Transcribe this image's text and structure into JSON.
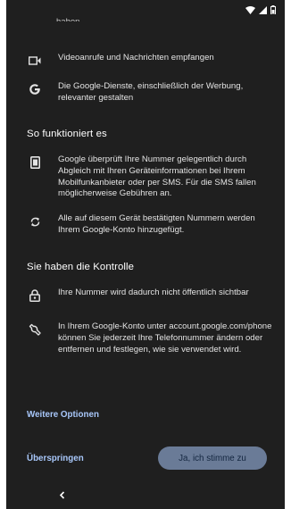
{
  "status_bar": {
    "icons": [
      "wifi-icon",
      "cell-signal-icon",
      "battery-icon"
    ]
  },
  "cut_text": "haben",
  "items_top": [
    {
      "icon": "video-camera-icon",
      "text": "Videoanrufe und Nachrichten empfangen"
    },
    {
      "icon": "google-g-icon",
      "text": "Die Google-Dienste, einschließlich der Werbung, relevanter gestalten"
    }
  ],
  "how_it_works": {
    "title": "So funktioniert es",
    "items": [
      {
        "icon": "sim-card-icon",
        "text": "Google überprüft Ihre Nummer gelegentlich durch Abgleich mit Ihren Geräteinformationen bei Ihrem Mobilfunkanbieter oder per SMS. Für die SMS fallen möglicherweise Gebühren an."
      },
      {
        "icon": "sync-icon",
        "text": "Alle auf diesem Gerät bestätigten Nummern werden Ihrem Google-Konto hinzugefügt."
      }
    ]
  },
  "control": {
    "title": "Sie haben die Kontrolle",
    "items": [
      {
        "icon": "lock-icon",
        "text": "Ihre Nummer wird dadurch nicht öffentlich sichtbar"
      },
      {
        "icon": "wrench-icon",
        "text": "In Ihrem Google-Konto unter account.google.com/phone können Sie jederzeit Ihre Telefonnummer ändern oder entfernen und festlegen, wie sie verwendet wird."
      }
    ]
  },
  "more_options": "Weitere Optionen",
  "actions": {
    "skip": "Überspringen",
    "agree": "Ja, ich stimme zu"
  },
  "nav": {
    "back_icon": "back-chevron-icon"
  }
}
